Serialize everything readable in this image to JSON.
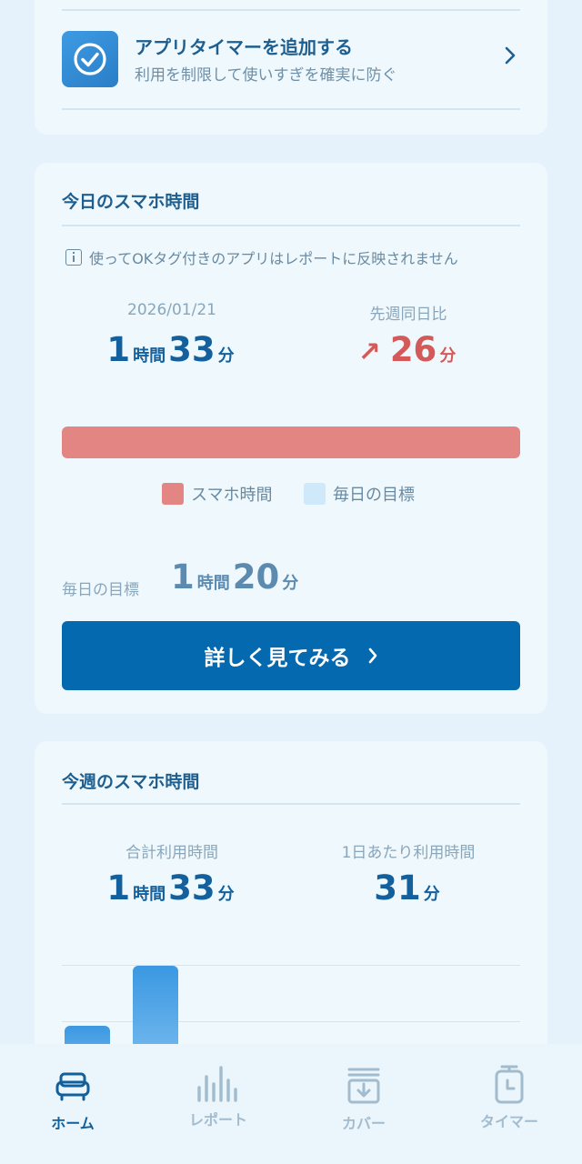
{
  "timer_card": {
    "title": "アプリタイマーを追加する",
    "subtitle": "利用を制限して使いすぎを確実に防ぐ"
  },
  "today": {
    "title": "今日のスマホ時間",
    "notice": "使ってOKタグ付きのアプリはレポートに反映されません",
    "date": "2026/01/21",
    "hours": "1",
    "hour_unit": "時間",
    "minutes": "33",
    "minute_unit": "分",
    "compare_label": "先週同日比",
    "compare_arrow": "↗",
    "compare_minutes": "26",
    "compare_unit": "分",
    "usage_fraction": 1.0,
    "legend_usage": "スマホ時間",
    "legend_goal": "毎日の目標",
    "goal_label": "毎日の目標",
    "goal_hours": "1",
    "goal_hour_unit": "時間",
    "goal_minutes": "20",
    "goal_minute_unit": "分",
    "detail_button": "詳しく見てみる",
    "colors": {
      "usage": "#e28583",
      "goal": "#cfe9fa",
      "accent": "#0569af",
      "increase": "#d45a5a"
    }
  },
  "week": {
    "title": "今週のスマホ時間",
    "total_label": "合計利用時間",
    "total_hours": "1",
    "total_hour_unit": "時間",
    "total_minutes": "33",
    "total_minute_unit": "分",
    "avg_label": "1日あたり利用時間",
    "avg_minutes": "31",
    "avg_unit": "分"
  },
  "tabs": [
    {
      "label": "ホーム",
      "icon": "sofa-icon",
      "active": true
    },
    {
      "label": "レポート",
      "icon": "bar-chart-icon",
      "active": false
    },
    {
      "label": "カバー",
      "icon": "cover-tray-icon",
      "active": false
    },
    {
      "label": "タイマー",
      "icon": "timer-icon",
      "active": false
    }
  ]
}
